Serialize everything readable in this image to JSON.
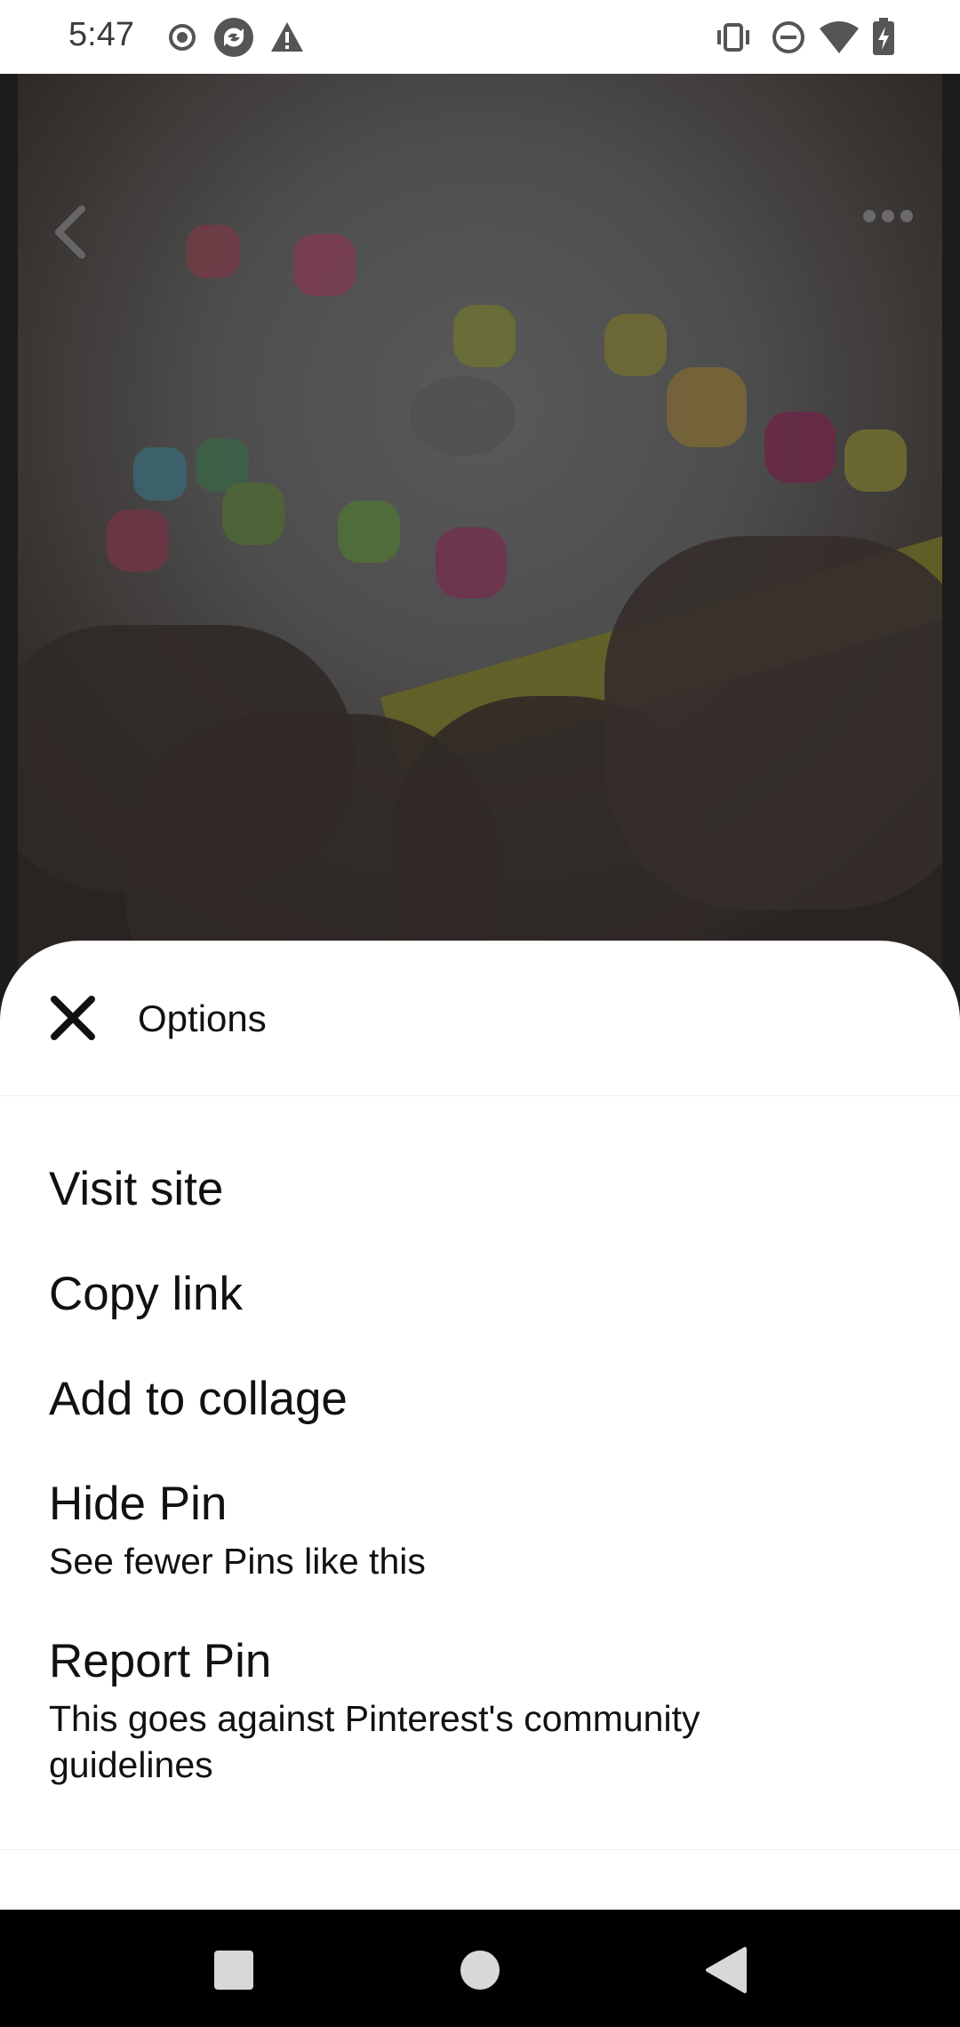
{
  "status_bar": {
    "time": "5:47",
    "left_icons": [
      "record-icon",
      "sync-app-icon",
      "warning-icon"
    ],
    "right_icons": [
      "vibrate-icon",
      "do-not-disturb-icon",
      "wifi-icon",
      "battery-charging-icon"
    ]
  },
  "pin": {
    "back_icon": "chevron-left-icon",
    "more_icon": "more-horizontal-icon"
  },
  "sheet": {
    "title": "Options",
    "close_icon": "close-icon",
    "items": [
      {
        "label": "Visit site"
      },
      {
        "label": "Copy link"
      },
      {
        "label": "Add to collage"
      },
      {
        "label": "Hide Pin",
        "subtitle": "See fewer Pins like this"
      },
      {
        "label": "Report Pin",
        "subtitle": "This goes against Pinterest's community guidelines"
      }
    ]
  },
  "nav_bar": {
    "icons": [
      "recents-square-icon",
      "home-circle-icon",
      "back-triangle-icon"
    ]
  },
  "colors": {
    "sheet_bg": "#ffffff",
    "text": "#111111",
    "nav_bg": "#000000"
  }
}
